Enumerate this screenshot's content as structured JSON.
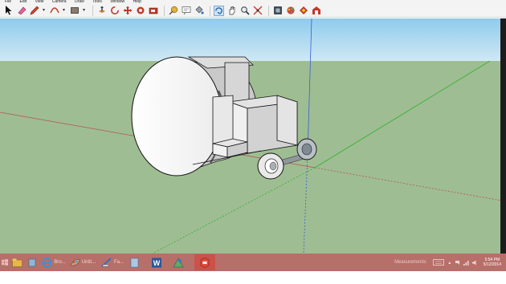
{
  "menubar": {
    "items": [
      "File",
      "Edit",
      "View",
      "Camera",
      "Draw",
      "Tools",
      "Window",
      "Help"
    ]
  },
  "toolbar": {
    "tools": [
      "select-tool",
      "eraser-tool",
      "pencil-tool",
      "arc-tool",
      "rectangle-tool",
      "push-pull-tool",
      "rotate-tool",
      "move-tool",
      "follow-me-tool",
      "scale-tool",
      "tape-measure-tool",
      "text-tool",
      "paint-bucket-tool",
      "orbit-tool",
      "pan-tool",
      "zoom-tool",
      "zoom-extents-tool",
      "components-tool",
      "materials-tool",
      "styles-tool",
      "warehouse-tool"
    ]
  },
  "colors": {
    "sky": "#afd9ef",
    "ground": "#9fbd92",
    "red_axis": "#b55353",
    "green_axis": "#2fb22f",
    "blue_axis": "#3a5fd0",
    "taskbar": "#b76f6a"
  },
  "taskbar": {
    "apps": [
      {
        "name": "file-explorer-icon",
        "label": ""
      },
      {
        "name": "internet-explorer-icon",
        "label": "Bro..."
      },
      {
        "name": "paint-icon",
        "label": "Untit..."
      },
      {
        "name": "sketchup-layout-icon",
        "label": "Fa..."
      },
      {
        "name": "word-icon",
        "label": ""
      },
      {
        "name": "style-builder-icon",
        "label": ""
      },
      {
        "name": "sketchup-icon",
        "label": ""
      }
    ],
    "measurements_label": "Measurements",
    "time": "5:54 PM",
    "date": "5/12/2014"
  }
}
